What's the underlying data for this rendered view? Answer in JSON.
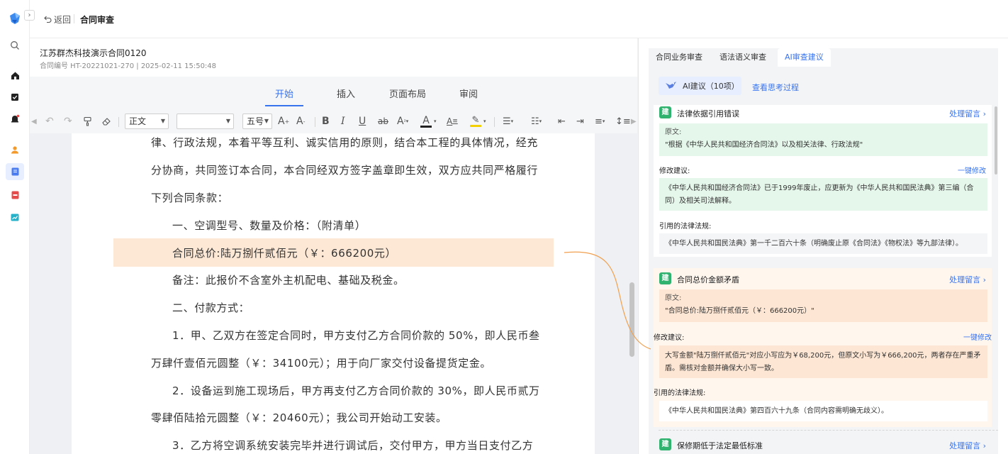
{
  "nav": {
    "back_label": "返回",
    "breadcrumb": "合同审查",
    "expand_glyph": "›"
  },
  "rail_icons": [
    "logo-icon",
    "search-icon",
    "home-icon",
    "task-icon",
    "bell-icon",
    "user-icon",
    "document-icon",
    "pdf-icon",
    "chart-icon"
  ],
  "document": {
    "title": "江苏群杰科技演示合同0120",
    "meta": "合同编号 HT-20221021-270 | 2025-02-11 15:50:48",
    "tabs": [
      {
        "label": "开始",
        "active": true
      },
      {
        "label": "插入",
        "active": false
      },
      {
        "label": "页面布局",
        "active": false
      },
      {
        "label": "审阅",
        "active": false
      }
    ],
    "toolbar": {
      "style_select": "正文",
      "font_select": "",
      "size_select": "五号"
    },
    "lines": [
      "律、行政法规，本着平等互利、诚实信用的原则，结合本工程的具体情况，经充",
      "分协商，共同签订本合同，本合同经双方签字盖章即生效，双方应共同严格履行",
      "下列合同条款：",
      "一、空调型号、数量及价格：（附清单）",
      "合同总价:陆万捌仟贰佰元（￥：666200元）",
      "备注：此报价不含室外主机配电、基础及税金。",
      "二、付款方式：",
      "1．甲、乙双方在签定合同时，甲方支付乙方合同价款的 50%，即人民币叁",
      "万肆仟壹佰元圆整（￥：34100元）；用于向厂家交付设备提货定金。",
      "2．设备运到施工现场后，甲方再支付乙方合同价款的 30%，即人民币贰万",
      "零肆佰陆拾元圆整（￥：20460元）；我公司开始动工安装。",
      "3．乙方将空调系统安装完毕并进行调试后，交付甲方，甲方当日支付乙方"
    ],
    "highlight_color": "#fde8d6"
  },
  "review_panel": {
    "tabs": [
      {
        "label": "合同业务审查",
        "active": false
      },
      {
        "label": "语法语义审查",
        "active": false
      },
      {
        "label": "AI审查建议",
        "active": true
      }
    ],
    "ai_chip": "AI建议（10项）",
    "think_link": "查看思考过程",
    "badge_char": "建",
    "handle_label": "处理留言",
    "one_click_label": "一键修改",
    "suggestion_label": "修改建议:",
    "law_label": "引用的法律法规:",
    "items": [
      {
        "title": "法律依据引用错误",
        "original_label": "原文:",
        "original": "\"根据《中华人民共和国经济合同法》以及相关法律、行政法规\"",
        "suggestion": "《中华人民共和国经济合同法》已于1999年废止，应更新为《中华人民共和国民法典》第三编（合同）及相关司法解释。",
        "law": "《中华人民共和国民法典》第一千二百六十条（明确废止原《合同法》《物权法》等九部法律）。"
      },
      {
        "title": "合同总价金额矛盾",
        "original_label": "原文:",
        "original": "\"合同总价:陆万捌仟贰佰元（￥：666200元）\"",
        "suggestion": "大写金额\"陆万捌仟贰佰元\"对应小写应为￥68,200元，但原文小写为￥666,200元，两者存在严重矛盾。需核对金额并确保大小写一致。",
        "law": "《中华人民共和国民法典》第四百六十九条（合同内容需明确无歧义）。"
      },
      {
        "title": "保修期低于法定最低标准"
      }
    ],
    "accent_color": "#3873ee",
    "badge_color": "#2fb36f",
    "link_line_color": "#f0a050"
  }
}
